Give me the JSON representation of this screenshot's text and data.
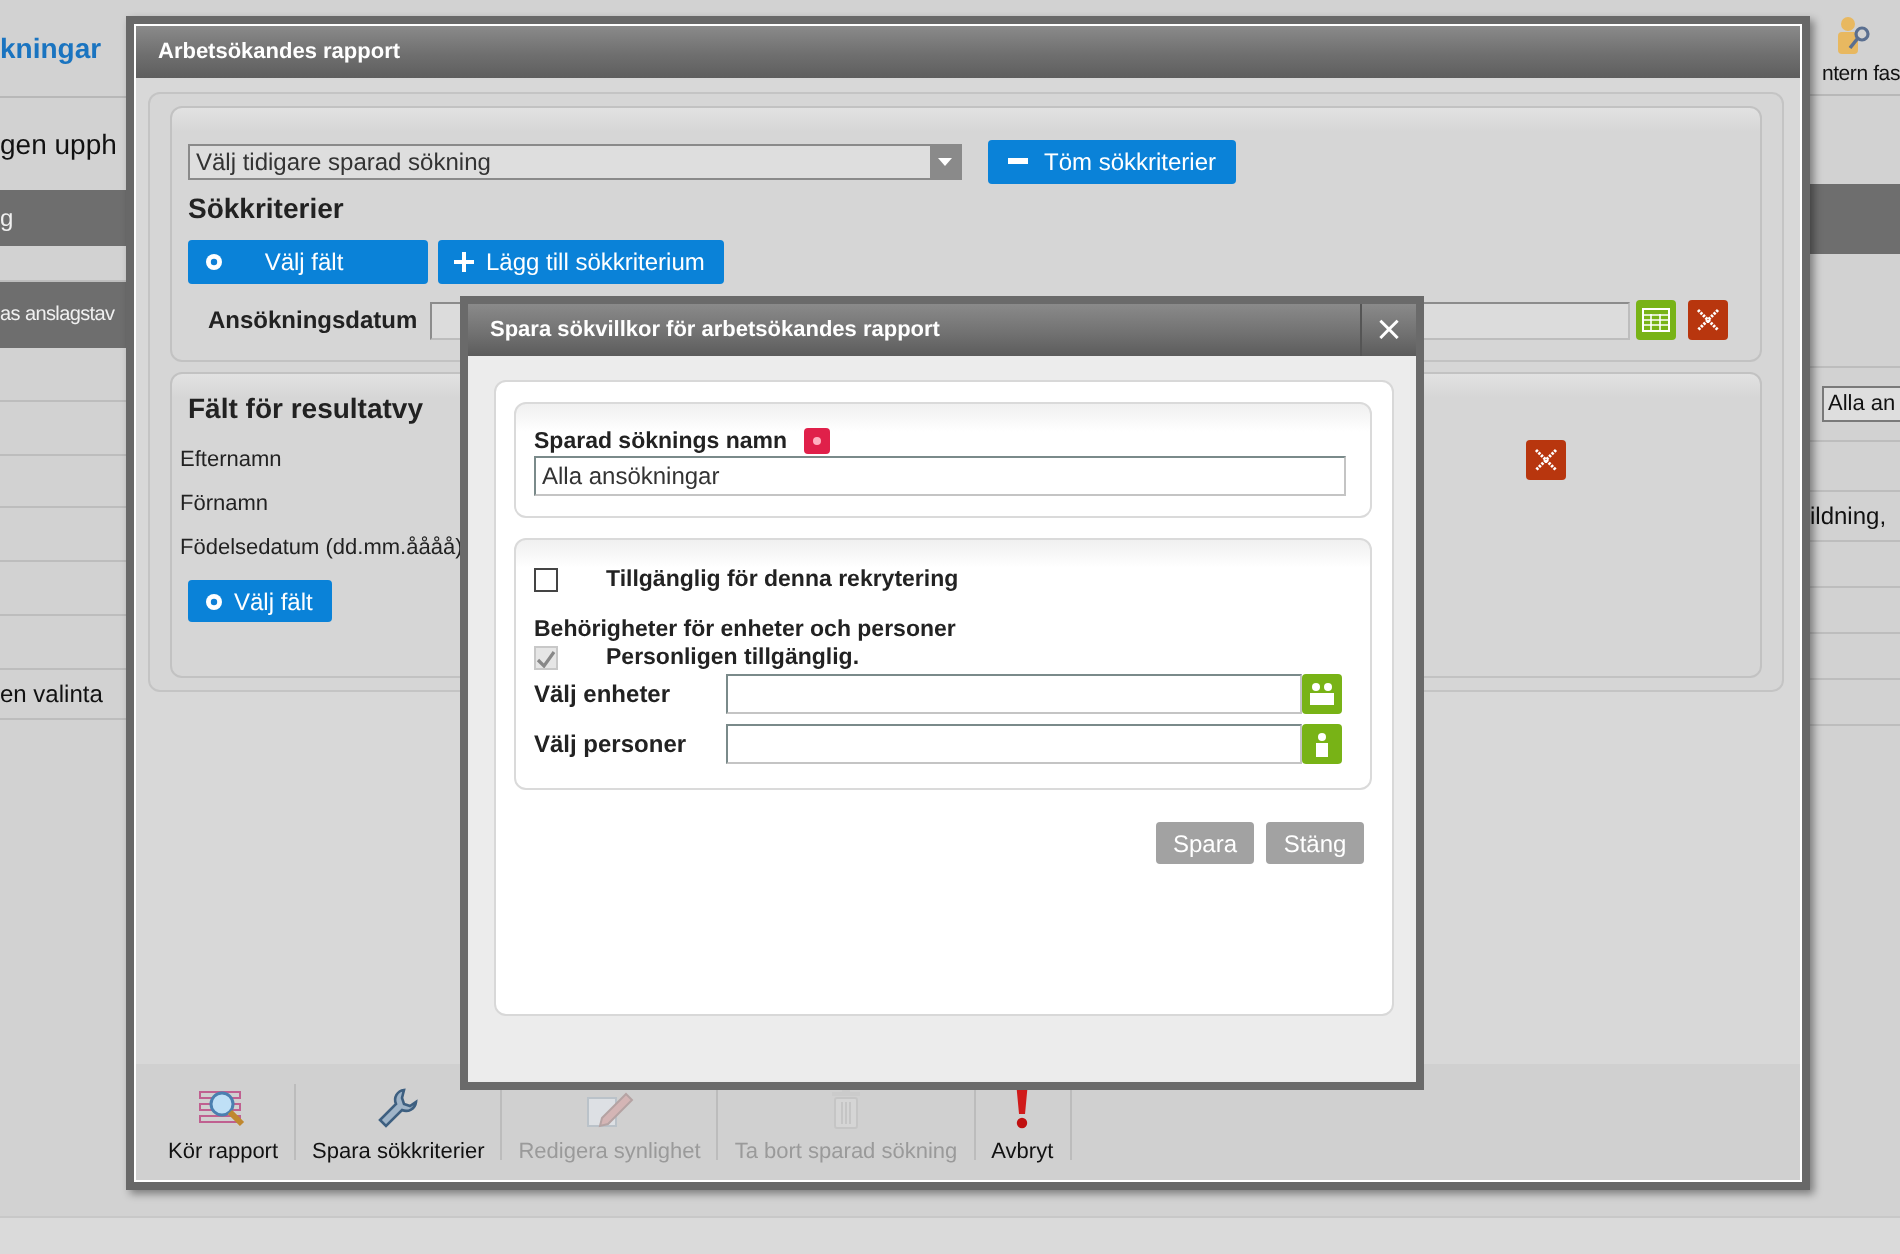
{
  "background": {
    "title": "kningar",
    "intro": "gen upph",
    "bar_text": "g",
    "board_text": "as anslagstav",
    "row_text": "en valinta",
    "action_label": "ntern fas",
    "filter_select": "Alla an",
    "cell_text": "ildning,"
  },
  "report_dialog": {
    "title": "Arbetsökandes rapport",
    "saved_search_select": "Välj tidigare sparad sökning",
    "clear_button": "Töm sökkriterier",
    "criteria_heading": "Sökkriterier",
    "choose_field_button": "Välj fält",
    "add_criterion_button": "Lägg till sökkriterium",
    "criteria": [
      {
        "label": "Ansökningsdatum"
      }
    ],
    "result_heading": "Fält för resultatvy",
    "result_fields": [
      {
        "label": "Efternamn",
        "removable": true
      },
      {
        "label": "Förnamn",
        "removable": false
      },
      {
        "label": "Födelsedatum (dd.mm.åååå)",
        "removable": false
      }
    ],
    "result_choose_button": "Välj fält",
    "toolbar": [
      {
        "label": "Kör rapport",
        "kind": "report",
        "disabled": false
      },
      {
        "label": "Spara sökkriterier",
        "kind": "wrench",
        "disabled": false
      },
      {
        "label": "Redigera synlighet",
        "kind": "edit",
        "disabled": true
      },
      {
        "label": "Ta bort sparad sökning",
        "kind": "trash",
        "disabled": true
      },
      {
        "label": "Avbryt",
        "kind": "abort",
        "disabled": false
      }
    ]
  },
  "save_dialog": {
    "title": "Spara sökvillkor för arbetsökandes rapport",
    "close": "×",
    "name_label": "Sparad söknings namn",
    "name_value": "Alla ansökningar",
    "available": {
      "label": "Tillgänglig för denna rekrytering",
      "checked": false
    },
    "permissions_heading": "Behörigheter för enheter och personer",
    "personal": {
      "label": "Personligen tillgänglig.",
      "checked": true,
      "disabled": true
    },
    "pickers": [
      {
        "label": "Välj enheter",
        "kind": "group"
      },
      {
        "label": "Välj personer",
        "kind": "person"
      }
    ],
    "buttons": [
      "Spara",
      "Stäng"
    ]
  }
}
